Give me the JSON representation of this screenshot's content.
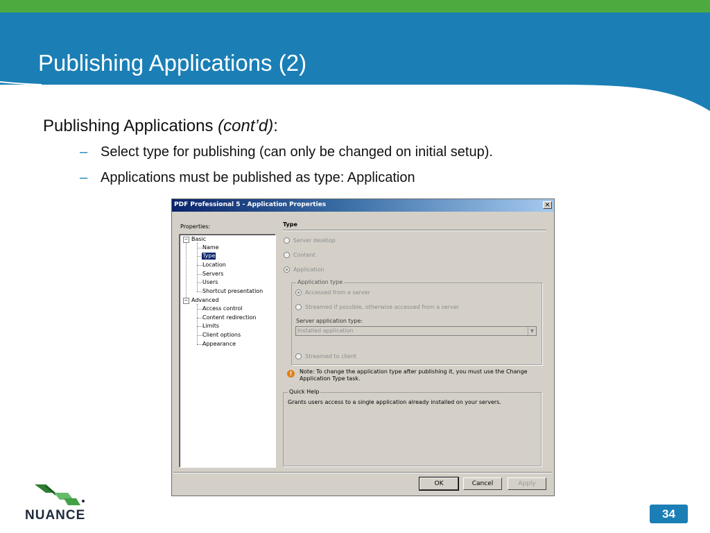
{
  "slide": {
    "title": "Publishing Applications (2)",
    "lead_text": "Publishing Applications ",
    "lead_italic": "(cont’d)",
    "lead_colon": ":",
    "bullets": [
      "Select type for publishing (can only be changed on initial setup).",
      "Applications must be published as type: Application"
    ],
    "page_number": "34",
    "logo_text": "NUANCE"
  },
  "dialog": {
    "title": "PDF Professional 5 - Application Properties",
    "properties_label": "Properties:",
    "tree": {
      "basic": {
        "label": "Basic",
        "children": [
          "Name",
          "Type",
          "Location",
          "Servers",
          "Users",
          "Shortcut presentation"
        ]
      },
      "advanced": {
        "label": "Advanced",
        "children": [
          "Access control",
          "Content redirection",
          "Limits",
          "Client options",
          "Appearance"
        ]
      },
      "selected": "Type"
    },
    "type_section": {
      "heading": "Type",
      "options": [
        "Server desktop",
        "Content",
        "Application"
      ],
      "selected_option": "Application",
      "application_type_group": "Application type",
      "app_type_options": [
        "Accessed from a server",
        "Streamed if possible, otherwise accessed from a server"
      ],
      "selected_app_type": "Accessed from a server",
      "server_app_type_label": "Server application type:",
      "server_app_type_value": "Installed application",
      "streamed_to_client": "Streamed to client"
    },
    "note": "Note: To change the application type after publishing it, you must use the Change Application Type task.",
    "quick_help": {
      "title": "Quick Help",
      "text": "Grants users access to a single application already installed on your servers."
    },
    "buttons": {
      "ok": "OK",
      "cancel": "Cancel",
      "apply": "Apply"
    }
  },
  "colors": {
    "header_blue": "#1b7fb6",
    "top_green": "#4caa3e",
    "title_bar": "#0a246a"
  }
}
